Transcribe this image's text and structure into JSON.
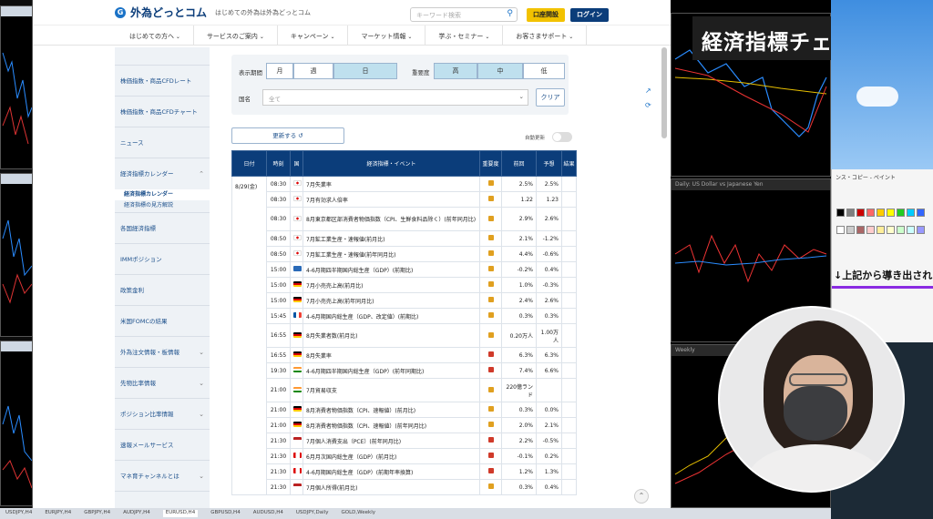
{
  "header": {
    "logo_text": "外為どっとコム",
    "logo_sub": "はじめての外為は外為どっとコム",
    "search_placeholder": "キーワード検索",
    "open_account": "口座開設",
    "login": "ログイン"
  },
  "nav": [
    "はじめての方へ",
    "サービスのご案内",
    "キャンペーン",
    "マーケット情報",
    "学ぶ・セミナー",
    "お客さまサポート"
  ],
  "sidebar": {
    "items": [
      {
        "label": "株価指数・商品CFDレート"
      },
      {
        "label": "株価指数・商品CFDチャート"
      },
      {
        "label": "ニュース"
      },
      {
        "label": "経済指標カレンダー"
      },
      {
        "label": "各国経済指標"
      },
      {
        "label": "IMMポジション"
      },
      {
        "label": "政策金利"
      },
      {
        "label": "米国FOMCの結果"
      },
      {
        "label": "外為注文情報・板情報"
      },
      {
        "label": "先物比率情報"
      },
      {
        "label": "ポジション比率情報"
      },
      {
        "label": "速報メールサービス"
      },
      {
        "label": "マネ育チャンネルとは"
      }
    ],
    "subitems": [
      "経済指標カレンダー",
      "経済指標の見方解説"
    ]
  },
  "filters": {
    "period_label": "表示期間",
    "period_options": [
      "月",
      "週",
      "日"
    ],
    "importance_label": "重要度",
    "importance_options": [
      "高",
      "中",
      "低"
    ],
    "country_label": "国名",
    "country_value": "全て",
    "clear": "クリア"
  },
  "update_button": "更新する ↺",
  "auto_update_label": "自動更新",
  "table": {
    "headers": [
      "日付",
      "時刻",
      "国",
      "経済指標・イベント",
      "重要度",
      "前回",
      "予想",
      "結果"
    ],
    "date": "8/29(金)",
    "rows": [
      {
        "time": "08:30",
        "flag": "jp",
        "event": "7月失業率",
        "imp": "mid",
        "prev": "2.5%",
        "fc": "2.5%"
      },
      {
        "time": "08:30",
        "flag": "jp",
        "event": "7月有効求人倍率",
        "imp": "mid",
        "prev": "1.22",
        "fc": "1.23"
      },
      {
        "time": "08:30",
        "flag": "jp",
        "event": "8月東京都区部消費者物価指数（CPI、生鮮食料品除く）(前年同月比)",
        "imp": "mid",
        "prev": "2.9%",
        "fc": "2.6%",
        "tall": true
      },
      {
        "time": "08:50",
        "flag": "jp",
        "event": "7月鉱工業生産・速報値(前月比)",
        "imp": "mid",
        "prev": "2.1%",
        "fc": "-1.2%"
      },
      {
        "time": "08:50",
        "flag": "jp",
        "event": "7月鉱工業生産・速報値(前年同月比)",
        "imp": "mid",
        "prev": "4.4%",
        "fc": "-0.6%"
      },
      {
        "time": "15:00",
        "flag": "se",
        "event": "4-6月期四半期国内総生産（GDP）(前期比)",
        "imp": "mid",
        "prev": "-0.2%",
        "fc": "0.4%"
      },
      {
        "time": "15:00",
        "flag": "de",
        "event": "7月小売売上高(前月比)",
        "imp": "mid",
        "prev": "1.0%",
        "fc": "-0.3%"
      },
      {
        "time": "15:00",
        "flag": "de",
        "event": "7月小売売上高(前年同月比)",
        "imp": "mid",
        "prev": "2.4%",
        "fc": "2.6%"
      },
      {
        "time": "15:45",
        "flag": "fr",
        "event": "4-6月期国内総生産（GDP、改定値）(前期比)",
        "imp": "mid",
        "prev": "0.3%",
        "fc": "0.3%"
      },
      {
        "time": "16:55",
        "flag": "de",
        "event": "8月失業者数(前月比)",
        "imp": "mid",
        "prev": "0.20万人",
        "fc": "1.00万人",
        "tall": true
      },
      {
        "time": "16:55",
        "flag": "de",
        "event": "8月失業率",
        "imp": "hi",
        "prev": "6.3%",
        "fc": "6.3%"
      },
      {
        "time": "19:30",
        "flag": "in",
        "event": "4-6月期四半期国内総生産（GDP）(前年同期比)",
        "imp": "hi",
        "prev": "7.4%",
        "fc": "6.6%"
      },
      {
        "time": "21:00",
        "flag": "in",
        "event": "7月貿易収支",
        "imp": "mid",
        "prev": "220億ランド",
        "fc": "",
        "tall": true
      },
      {
        "time": "21:00",
        "flag": "de",
        "event": "8月消費者物価指数（CPI、速報値）(前月比)",
        "imp": "mid",
        "prev": "0.3%",
        "fc": "0.0%"
      },
      {
        "time": "21:00",
        "flag": "de",
        "event": "8月消費者物価指数（CPI、速報値）(前年同月比)",
        "imp": "mid",
        "prev": "2.0%",
        "fc": "2.1%"
      },
      {
        "time": "21:30",
        "flag": "us",
        "event": "7月個人消費支出（PCE）(前年同月比)",
        "imp": "hi",
        "prev": "2.2%",
        "fc": "-0.5%"
      },
      {
        "time": "21:30",
        "flag": "ca",
        "event": "6月月次国内総生産（GDP）(前月比)",
        "imp": "hi",
        "prev": "-0.1%",
        "fc": "0.2%"
      },
      {
        "time": "21:30",
        "flag": "ca",
        "event": "4-6月期国内総生産（GDP）(前期年率換算)",
        "imp": "hi",
        "prev": "1.2%",
        "fc": "1.3%"
      },
      {
        "time": "21:30",
        "flag": "us",
        "event": "7月個人所得(前月比)",
        "imp": "mid",
        "prev": "0.3%",
        "fc": "0.4%"
      }
    ]
  },
  "overlay_title": "経済指標チェック",
  "paint": {
    "title": "ンス・コピー - ペイント",
    "text": "↓上記から導き出され"
  },
  "right_charts": {
    "chart2_title": "Daily: US Dollar vs Japanese Yen",
    "chart3_title": "Weekly"
  },
  "taskbar": [
    "USDJPY,H4",
    "EURJPY,H4",
    "GBPJPY,H4",
    "AUDJPY,H4",
    "EURUSD,H4",
    "GBPUSD,H4",
    "AUDUSD,H4",
    "USDJPY,Daily",
    "GOLD,Weekly"
  ],
  "colors": {
    "navy": "#0b3d7a",
    "accent": "#f2c200",
    "seg_on": "#bfe0ee"
  }
}
